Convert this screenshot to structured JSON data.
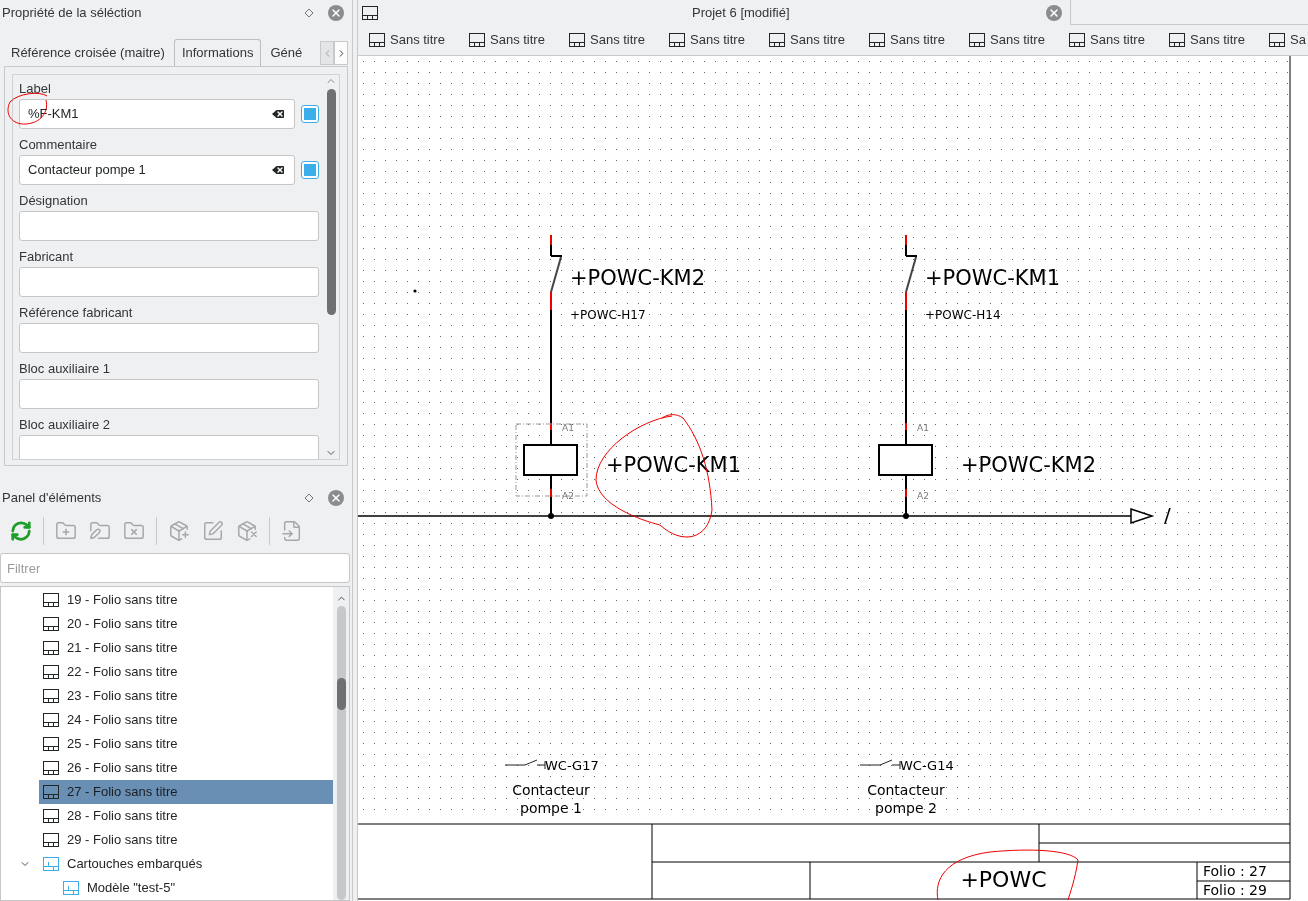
{
  "properties_panel": {
    "title": "Propriété de la séléction",
    "tabs": [
      {
        "label": "Référence croisée (maitre)",
        "selected": false
      },
      {
        "label": "Informations",
        "selected": true
      },
      {
        "label": "Géné",
        "selected": false
      }
    ],
    "fields": [
      {
        "label": "Label",
        "value": "%F-KM1",
        "kind": "clearable",
        "checked": true
      },
      {
        "label": "Commentaire",
        "value": "Contacteur pompe 1",
        "kind": "clearable",
        "checked": true
      },
      {
        "label": "Désignation",
        "kind": "plain"
      },
      {
        "label": "Fabricant",
        "kind": "plain"
      },
      {
        "label": "Référence fabricant",
        "kind": "plain"
      },
      {
        "label": "Bloc auxiliaire 1",
        "kind": "plain"
      },
      {
        "label": "Bloc auxiliaire 2",
        "kind": "plain"
      }
    ]
  },
  "elements_panel": {
    "title": "Panel d'éléments",
    "toolbar": [
      {
        "kind": "reload",
        "disabled": false
      },
      {
        "kind": "folder-add",
        "disabled": true
      },
      {
        "kind": "folder-edit",
        "disabled": true
      },
      {
        "kind": "folder-delete",
        "disabled": true
      },
      {
        "kind": "element-add",
        "disabled": true
      },
      {
        "kind": "element-edit",
        "disabled": true
      },
      {
        "kind": "element-delete",
        "disabled": true
      },
      {
        "kind": "import",
        "disabled": true
      }
    ],
    "filter": {
      "placeholder": "Filtrer"
    },
    "tree": [
      {
        "label": "19 - Folio sans titre",
        "kind": "folio",
        "selected": false
      },
      {
        "label": "20 - Folio sans titre",
        "kind": "folio",
        "selected": false
      },
      {
        "label": "21 - Folio sans titre",
        "kind": "folio",
        "selected": false
      },
      {
        "label": "22 - Folio sans titre",
        "kind": "folio",
        "selected": false
      },
      {
        "label": "23 - Folio sans titre",
        "kind": "folio",
        "selected": false
      },
      {
        "label": "24 - Folio sans titre",
        "kind": "folio",
        "selected": false
      },
      {
        "label": "25 - Folio sans titre",
        "kind": "folio",
        "selected": false
      },
      {
        "label": "26 - Folio sans titre",
        "kind": "folio",
        "selected": false
      },
      {
        "label": "27 - Folio sans titre",
        "kind": "folio",
        "selected": true
      },
      {
        "label": "28 - Folio sans titre",
        "kind": "folio",
        "selected": false
      },
      {
        "label": "29 - Folio sans titre",
        "kind": "folio",
        "selected": false
      },
      {
        "label": "Cartouches embarqués",
        "kind": "titleblock-group",
        "selected": false,
        "expanded": true,
        "children": [
          {
            "label": "Modèle \"test-5\"",
            "kind": "titleblock",
            "selected": false
          }
        ]
      }
    ]
  },
  "document": {
    "title": "Projet 6 [modifié]",
    "folio_tabs": [
      "Sans titre",
      "Sans titre",
      "Sans titre",
      "Sans titre",
      "Sans titre",
      "Sans titre",
      "Sans titre",
      "Sans titre",
      "Sans titre",
      "Sa"
    ],
    "branches": [
      {
        "contact_label": "+POWC-KM2",
        "contact_ref": "+POWC-H17",
        "coil_label": "+POWC-KM1",
        "terminals": [
          "A1",
          "A2"
        ],
        "selected": true,
        "aux_ref": "WC-G17",
        "comment": "Contacteur pompe 1"
      },
      {
        "contact_label": "+POWC-KM1",
        "contact_ref": "+POWC-H14",
        "coil_label": "+POWC-KM2",
        "terminals": [
          "A1",
          "A2"
        ],
        "selected": false,
        "aux_ref": "WC-G14",
        "comment": "Contacteur pompe 2"
      }
    ],
    "bus_label": "/",
    "title_block": {
      "location": "+POWC",
      "folios": [
        "Folio : 27",
        "Folio : 29"
      ]
    }
  }
}
